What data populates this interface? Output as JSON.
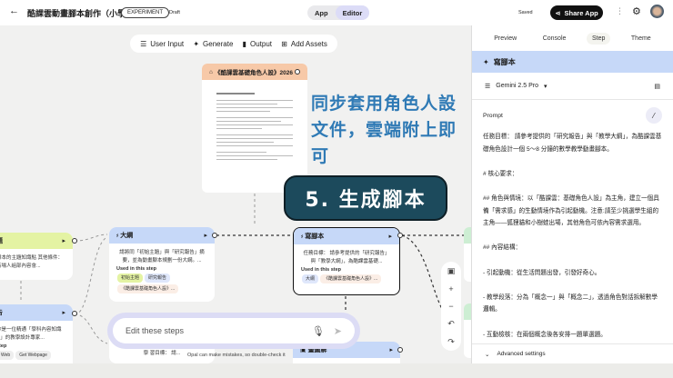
{
  "header": {
    "title": "酷課雲動畫腳本創作（小學",
    "badge": "EXPERIMENT",
    "status": "Draft",
    "modes": [
      "App",
      "Editor"
    ],
    "saved": "Saved",
    "share": "Share App"
  },
  "toolbar": [
    "User Input",
    "Generate",
    "Output",
    "Add Assets"
  ],
  "doc_node": {
    "title": "《酷課雲基礎角色人設》2026"
  },
  "overlay": {
    "caption": "同步套用角色人設文件，雲端附上即可",
    "step": "5. 生成腳本"
  },
  "nodes": {
    "topic": {
      "title": "題",
      "body": "腳本的主題知識點 其他條件：有場人組部內容會..."
    },
    "report": {
      "title": "告",
      "body": "你是一位精通「學科內容知識Q」的教學設計專家...",
      "used": "step",
      "tags": [
        "Web",
        "Get Webpage"
      ]
    },
    "outline": {
      "title": "大綱",
      "body": "請將同「初始主題」與「研究報告」摘要，並為動畫腳本規劃一份大綱。...",
      "used": "Used in this step",
      "tags": [
        "初始主題",
        "研究報告",
        "《酷課雲基礎角色人設》..."
      ]
    },
    "script": {
      "title": "寫腳本",
      "body": "任務目標： 請參考提供的「研究報告」與「教學大綱」，為酷課雲基礎...",
      "used": "Used in this step",
      "tags": [
        "大綱",
        "《酷課雲基礎角色人設》..."
      ]
    },
    "diagram": {
      "title": "畫圖解"
    },
    "hidden": {
      "body": "研究報告 整理成一份適合 內容結構， 小學 習目標： 請..."
    }
  },
  "edit": {
    "placeholder": "Edit these steps",
    "disclaimer": "Opal can make mistakes, so double-check it"
  },
  "panel": {
    "tabs": [
      "Preview",
      "Console",
      "Step",
      "Theme"
    ],
    "active_tab": "Step",
    "step_title": "寫腳本",
    "model": "Gemini 2.5 Pro",
    "prompt_label": "Prompt",
    "prompt": [
      "任務目標： 請參考提供的「研究報告」與「教學大綱」，為酷課雲基礎角色設計一個 5～8 分鐘的數學教學動畫腳本。",
      "",
      "# 核心要求：",
      "",
      "## 角色與情境：以「酷課雲：基礎角色人設」為主角，建立一個具備「需求感」的生動情境作為引起動機。注意:請至少挑選學生組的主角——狐狸貓和小樹蛙出場，其他角色可依內容需求選用。",
      "",
      "## 內容結構：",
      "",
      "- 引起動機：從生活問題出發，引發好奇心。",
      "",
      "- 教學段落：分為「概念一」與「概念二」，透過角色對話拆解數學邏輯。",
      "",
      "- 互動檢核：在兩個概念後各安排一題單選題。"
    ],
    "advanced": "Advanced settings"
  },
  "colors": {
    "node_blue": "#c6d8f8",
    "node_yellow": "#e4f3a3",
    "doc_orange": "#f7c9a8",
    "overlay_text": "#2f7ab5",
    "step_pill": "#1c4a5c"
  }
}
